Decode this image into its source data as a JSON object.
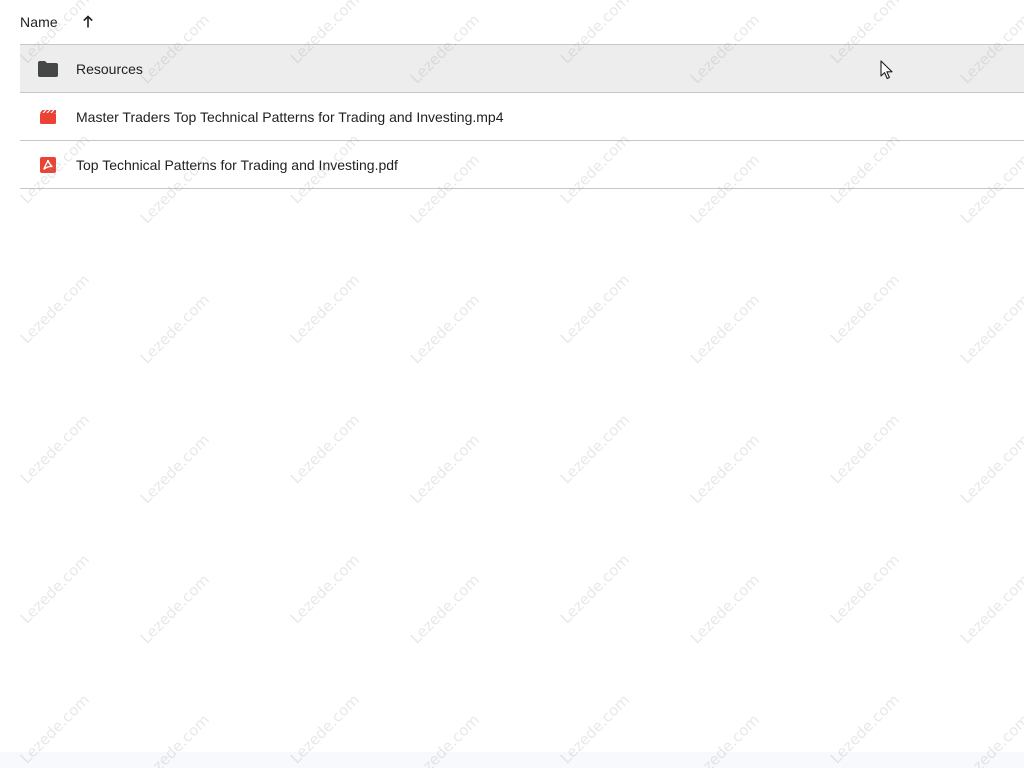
{
  "header": {
    "name_label": "Name",
    "sort_icon": "arrow-up-icon"
  },
  "files": [
    {
      "name": "Resources",
      "type": "folder",
      "icon": "folder-icon",
      "hovered": true
    },
    {
      "name": "Master Traders Top Technical Patterns for Trading and Investing.mp4",
      "type": "video",
      "icon": "video-file-icon",
      "hovered": false
    },
    {
      "name": "Top Technical Patterns for Trading and Investing.pdf",
      "type": "pdf",
      "icon": "pdf-file-icon",
      "hovered": false
    }
  ],
  "watermark": {
    "text": "Lezede.com"
  },
  "colors": {
    "folder": "#444746",
    "video": "#ea4335",
    "pdf": "#ea4335",
    "row_hover": "#ededed",
    "divider": "#c7c7c7"
  }
}
